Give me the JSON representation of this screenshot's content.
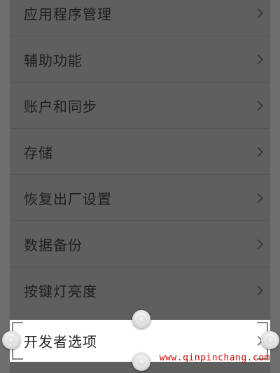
{
  "settings_list": {
    "items": [
      {
        "label": "应用程序管理"
      },
      {
        "label": "辅助功能"
      },
      {
        "label": "账户和同步"
      },
      {
        "label": "存储"
      },
      {
        "label": "恢复出厂设置"
      },
      {
        "label": "数据备份"
      },
      {
        "label": "按键灯亮度"
      }
    ]
  },
  "highlighted_item": {
    "label": "开发者选项"
  },
  "watermark": {
    "text": "www.qinpinchang.com"
  },
  "colors": {
    "dim_background": "#6e6e6e",
    "highlight_background": "#ffffff",
    "watermark": "#d60000"
  }
}
